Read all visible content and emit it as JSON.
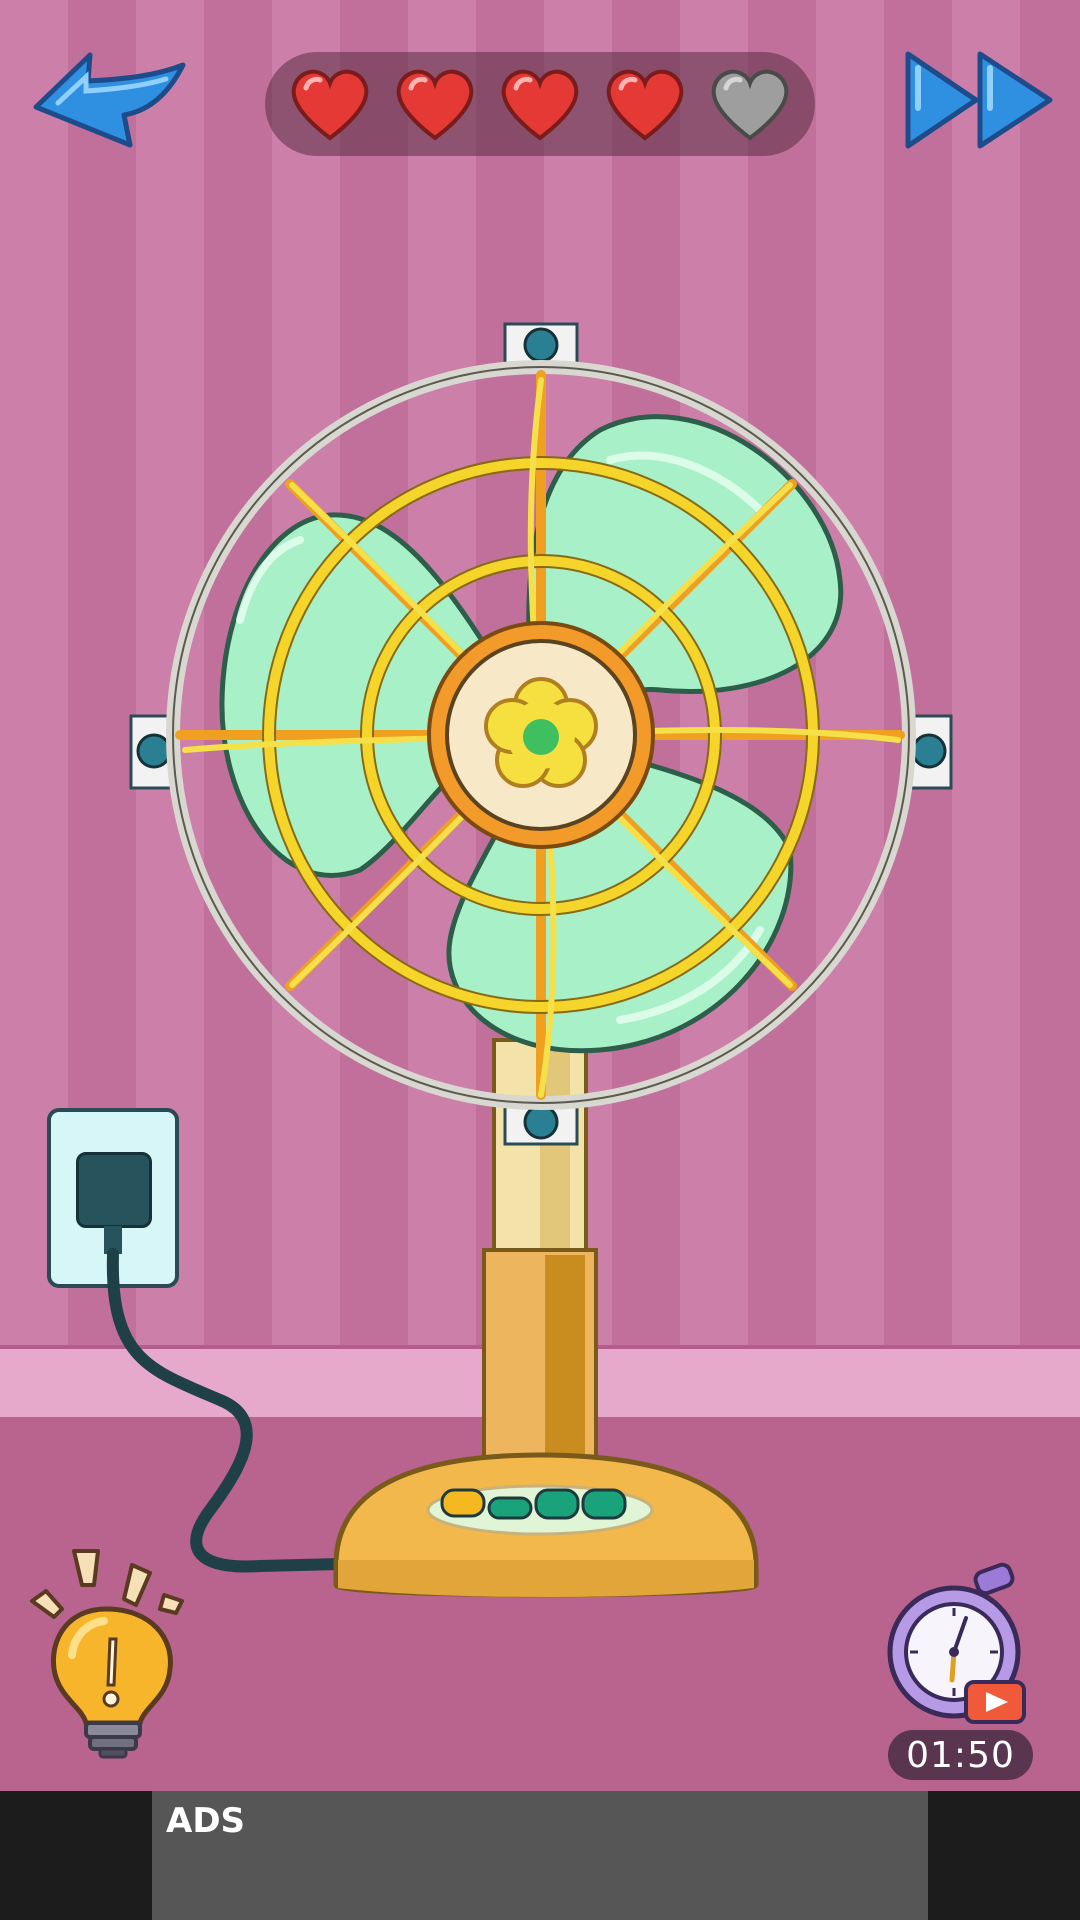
{
  "hud": {
    "back_icon": "back-arrow-icon",
    "skip_icon": "fast-forward-icon",
    "hearts": [
      {
        "state": "full",
        "color": "#e53935"
      },
      {
        "state": "full",
        "color": "#e53935"
      },
      {
        "state": "full",
        "color": "#e53935"
      },
      {
        "state": "full",
        "color": "#e53935"
      },
      {
        "state": "empty",
        "color": "#9e9e9e"
      }
    ],
    "lives_remaining": 4,
    "lives_total": 5
  },
  "scene": {
    "fan_blade_color": "#a8f0c8",
    "fan_guard_color": "#f5d52a",
    "fan_base_color": "#f2b84b",
    "control_buttons": [
      "#f5b820",
      "#1aa37a",
      "#1aa37a",
      "#1aa37a"
    ]
  },
  "hint": {
    "icon": "lightbulb-hint-icon"
  },
  "timer": {
    "icon": "stopwatch-video-icon",
    "value": "01:50"
  },
  "ads": {
    "label": "ADS"
  }
}
